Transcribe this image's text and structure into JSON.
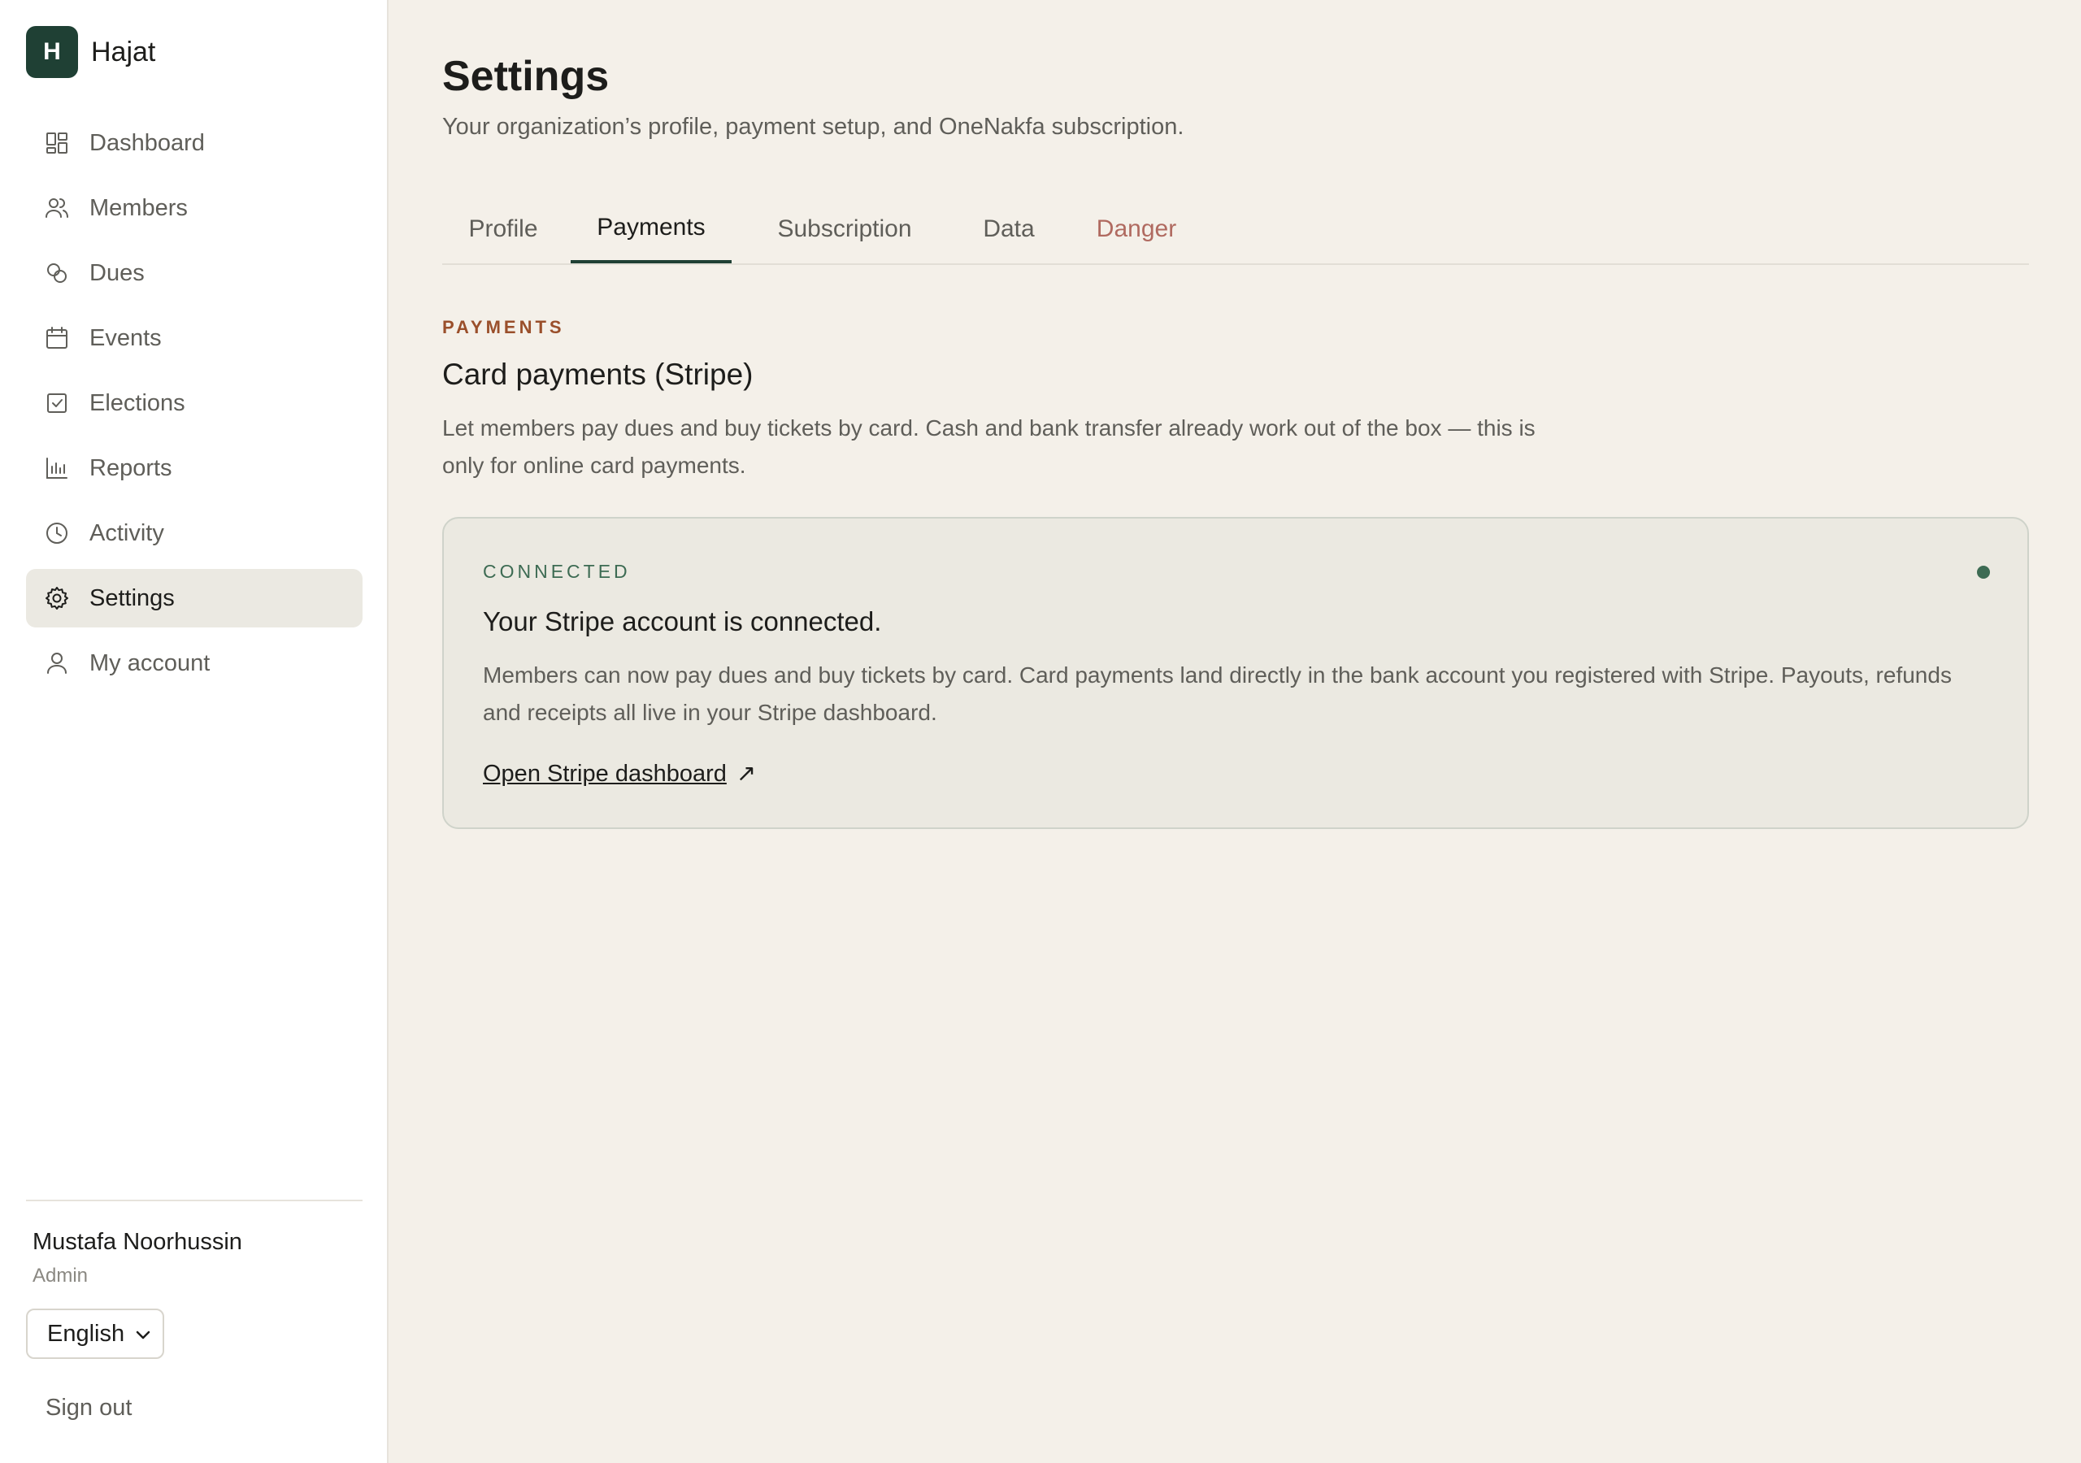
{
  "app": {
    "logo_letter": "H",
    "name": "Hajat"
  },
  "sidebar": {
    "items": [
      {
        "label": "Dashboard",
        "icon": "dashboard-icon"
      },
      {
        "label": "Members",
        "icon": "users-icon"
      },
      {
        "label": "Dues",
        "icon": "coins-icon"
      },
      {
        "label": "Events",
        "icon": "calendar-icon"
      },
      {
        "label": "Elections",
        "icon": "ballot-check-icon"
      },
      {
        "label": "Reports",
        "icon": "bar-chart-icon"
      },
      {
        "label": "Activity",
        "icon": "clock-icon"
      },
      {
        "label": "Settings",
        "icon": "gear-icon",
        "active": true
      },
      {
        "label": "My account",
        "icon": "user-icon"
      }
    ],
    "user": {
      "name": "Mustafa Noorhussin",
      "role": "Admin"
    },
    "language": {
      "selected": "English"
    },
    "sign_out_label": "Sign out"
  },
  "page": {
    "title": "Settings",
    "subtitle": "Your organization’s profile, payment setup, and OneNakfa subscription."
  },
  "tabs": [
    {
      "label": "Profile"
    },
    {
      "label": "Payments",
      "active": true
    },
    {
      "label": "Subscription"
    },
    {
      "label": "Data"
    },
    {
      "label": "Danger"
    }
  ],
  "payments": {
    "kicker": "PAYMENTS",
    "title": "Card payments (Stripe)",
    "description": "Let members pay dues and buy tickets by card. Cash and bank transfer already work out of the box — this is only for online card payments.",
    "status": {
      "label": "CONNECTED",
      "title": "Your Stripe account is connected.",
      "description": "Members can now pay dues and buy tickets by card. Card payments land directly in the bank account you registered with Stripe. Payouts, refunds and receipts all live in your Stripe dashboard.",
      "link_label": "Open Stripe dashboard",
      "link_icon": "external-link-icon",
      "link_arrow": "↗"
    }
  },
  "colors": {
    "accent": "#1f4034",
    "kicker": "#9a4f2b",
    "success": "#3d6b53",
    "danger": "#b06a60",
    "background": "#f4f0e9"
  }
}
